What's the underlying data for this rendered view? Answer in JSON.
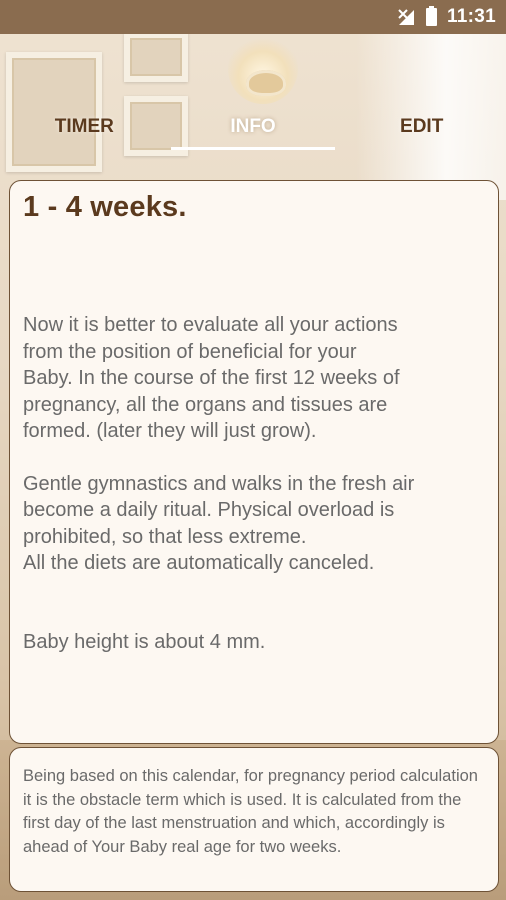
{
  "status_bar": {
    "time": "11:31",
    "icons": [
      "no-signal-icon",
      "battery-icon"
    ]
  },
  "tabs": [
    {
      "label": "TIMER",
      "active": false
    },
    {
      "label": "INFO",
      "active": true
    },
    {
      "label": "EDIT",
      "active": false
    }
  ],
  "info": {
    "title": "1 - 4 weeks.",
    "paragraph1": "Now it is better to evaluate all your actions\nfrom the position of beneficial for your\nBaby. In the course of the first 12 weeks of\npregnancy, all the organs and tissues are\nformed. (later they will just grow).",
    "paragraph2": "Gentle gymnastics and walks in the fresh air\nbecome a daily ritual. Physical overload is\nprohibited, so that less extreme.\nAll the diets are automatically canceled.",
    "paragraph3": "Baby height is about 4 mm."
  },
  "note": {
    "text": "Being based on this calendar, for pregnancy period calculation it is the obstacle term which is used. It is calculated from the first day of the last menstruation and which, accordingly is ahead of Your Baby real age for two weeks."
  },
  "colors": {
    "status_bar": "#8a6c4f",
    "title_brown": "#5b3a1e",
    "card_bg": "#fdf8f2",
    "card_border": "#6e5236",
    "body_text": "#6a6a6a"
  }
}
